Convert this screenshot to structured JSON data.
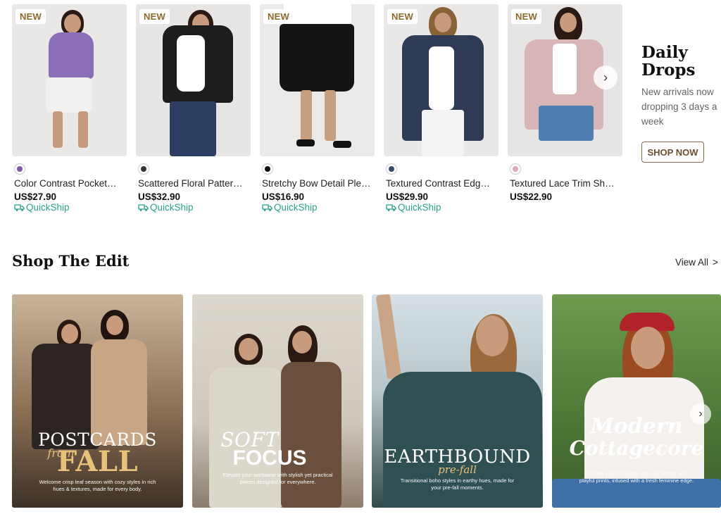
{
  "products": [
    {
      "badge": "NEW",
      "name": "Color Contrast Pocket…",
      "price": "US$27.90",
      "quickship": "QuickShip",
      "swatch": "#7a5aa6"
    },
    {
      "badge": "NEW",
      "name": "Scattered Floral Patter…",
      "price": "US$32.90",
      "quickship": "QuickShip",
      "swatch": "#333333"
    },
    {
      "badge": "NEW",
      "name": "Stretchy Bow Detail Ple…",
      "price": "US$16.90",
      "quickship": "QuickShip",
      "swatch": "#111111"
    },
    {
      "badge": "NEW",
      "name": "Textured Contrast Edg…",
      "price": "US$29.90",
      "quickship": "QuickShip",
      "swatch": "#3a4a6a"
    },
    {
      "badge": "NEW",
      "name": "Textured Lace Trim Sh…",
      "price": "US$22.90",
      "quickship": "",
      "swatch": "#d9a9b4"
    }
  ],
  "daily_drops": {
    "title": "Daily Drops",
    "subtitle": "New arrivals now dropping 3 days a week",
    "cta": "SHOP NOW"
  },
  "edit": {
    "title": "Shop The Edit",
    "view_all": "View All",
    "tiles": [
      {
        "line1": "POSTCARDS",
        "line2": "from",
        "line3": "FALL",
        "desc": "Welcome crisp leaf season with cozy styles in rich hues & textures, made for every body."
      },
      {
        "line1": "SOFT",
        "line2": "",
        "line3": "FOCUS",
        "desc": "Elevate your workwear with stylish yet practical pieces designed for everywhere."
      },
      {
        "line1": "EARTHBOUND",
        "line2": "pre-fall",
        "line3": "",
        "desc": "Transitional boho styles in earthy hues, made for your pre-fall moments."
      },
      {
        "line1": "Modern",
        "line2": "Cottagecore",
        "line3": "",
        "desc": "Elevate your everyday with airy fabrics and playful prints, infused with a fresh feminine edge."
      }
    ]
  },
  "colors": {
    "quickship": "#27a38a",
    "badge_text": "#8a6a2e",
    "cta_border": "#8a6a4a"
  }
}
